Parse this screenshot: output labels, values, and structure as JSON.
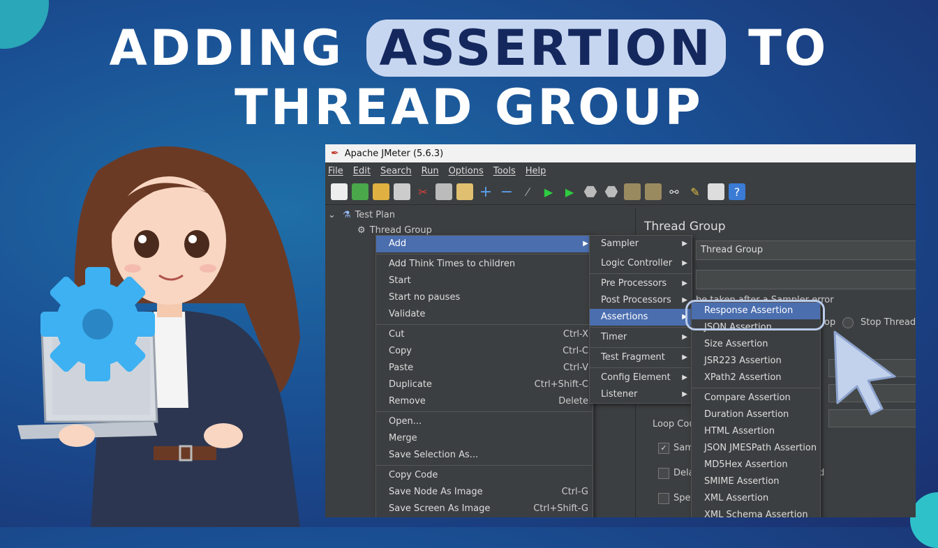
{
  "headline": {
    "line1_pre": "ADDING",
    "line1_highlight": "ASSERTION",
    "line1_post": "TO",
    "line2": "THREAD GROUP"
  },
  "colors": {
    "accent": "#4b6eaf",
    "headline_pill": "#c7d6f0",
    "bg_top": "#1f6fa8",
    "bg_bottom": "#1b2f6e"
  },
  "window": {
    "title": "Apache JMeter (5.6.3)",
    "menus": [
      "File",
      "Edit",
      "Search",
      "Run",
      "Options",
      "Tools",
      "Help"
    ],
    "toolbar_icons": [
      "new-icon",
      "templates-icon",
      "open-icon",
      "save-icon",
      "cut-icon",
      "copy-icon",
      "paste-icon",
      "expand-icon",
      "collapse-icon",
      "toggle-icon",
      "start-icon",
      "start-no-pause-icon",
      "stop-icon",
      "shutdown-icon",
      "clear-icon",
      "clear-all-icon",
      "search-icon",
      "reset-search-icon",
      "function-helper-icon",
      "help-icon"
    ]
  },
  "tree": {
    "items": [
      {
        "label": "Test Plan"
      },
      {
        "label": "Thread Group"
      }
    ]
  },
  "right_panel": {
    "title": "Thread Group",
    "name_value": "Thread Group",
    "action_label": "be taken after a Sampler error",
    "stop_thread": "Stop Thread",
    "loop_count": "Loop Cou",
    "same_user": "Sam",
    "delay": "Dela",
    "specify": "Spec",
    "partial_top": "op",
    "partial_d": "d"
  },
  "context_menu": {
    "items": [
      {
        "label": "Add",
        "selected": true,
        "submenu": true
      },
      {
        "sep": true
      },
      {
        "label": "Add Think Times to children"
      },
      {
        "label": "Start"
      },
      {
        "label": "Start no pauses"
      },
      {
        "label": "Validate"
      },
      {
        "sep": true
      },
      {
        "label": "Cut",
        "shortcut": "Ctrl-X"
      },
      {
        "label": "Copy",
        "shortcut": "Ctrl-C"
      },
      {
        "label": "Paste",
        "shortcut": "Ctrl-V"
      },
      {
        "label": "Duplicate",
        "shortcut": "Ctrl+Shift-C"
      },
      {
        "label": "Remove",
        "shortcut": "Delete"
      },
      {
        "sep": true
      },
      {
        "label": "Open..."
      },
      {
        "label": "Merge"
      },
      {
        "label": "Save Selection As..."
      },
      {
        "sep": true
      },
      {
        "label": "Copy Code"
      },
      {
        "label": "Save Node As Image",
        "shortcut": "Ctrl-G"
      },
      {
        "label": "Save Screen As Image",
        "shortcut": "Ctrl+Shift-G"
      }
    ]
  },
  "add_submenu": {
    "items": [
      {
        "label": "Sampler"
      },
      {
        "label": "Logic Controller"
      },
      {
        "label": "Pre Processors"
      },
      {
        "label": "Post Processors"
      },
      {
        "label": "Assertions",
        "selected": true
      },
      {
        "label": "Timer"
      },
      {
        "label": "Test Fragment"
      },
      {
        "label": "Config Element"
      },
      {
        "label": "Listener"
      }
    ]
  },
  "assertions_submenu": {
    "items": [
      {
        "label": "Response Assertion",
        "selected": true
      },
      {
        "label": "JSON Assertion"
      },
      {
        "label": "Size Assertion"
      },
      {
        "label": "JSR223 Assertion"
      },
      {
        "label": "XPath2 Assertion"
      },
      {
        "sep": true
      },
      {
        "label": "Compare Assertion"
      },
      {
        "label": "Duration Assertion"
      },
      {
        "label": "HTML Assertion"
      },
      {
        "label": "JSON JMESPath Assertion"
      },
      {
        "label": "MD5Hex Assertion"
      },
      {
        "label": "SMIME Assertion"
      },
      {
        "label": "XML Assertion"
      },
      {
        "label": "XML Schema Assertion"
      }
    ]
  }
}
